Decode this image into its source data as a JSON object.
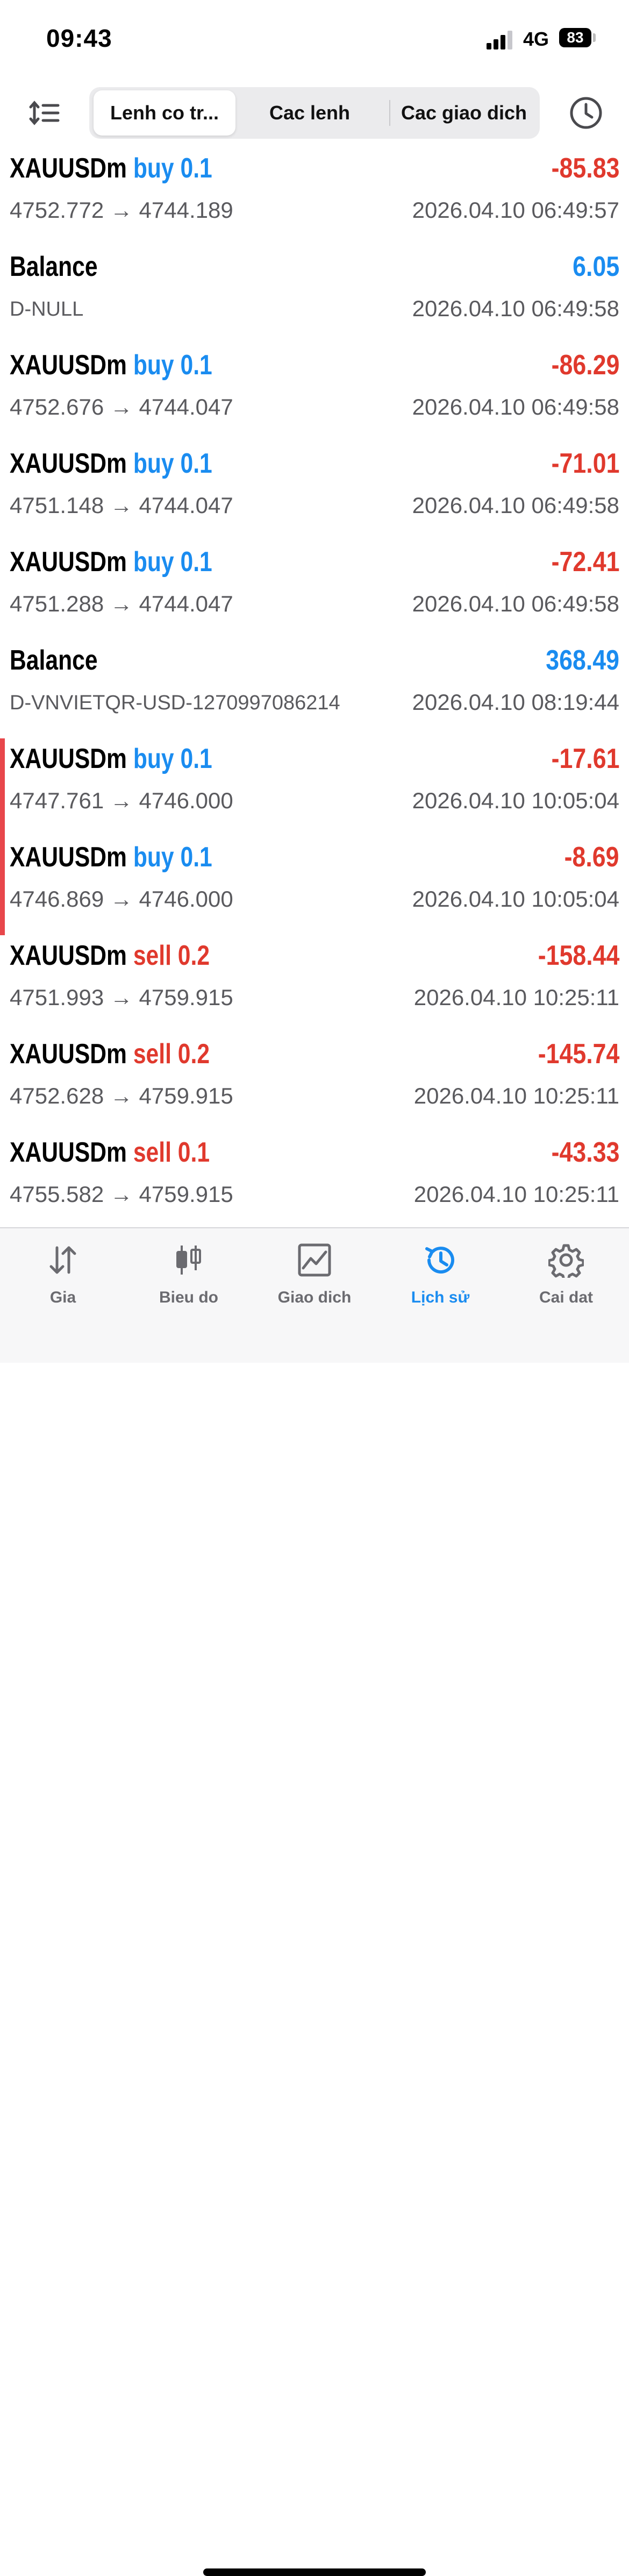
{
  "status_bar": {
    "time": "09:43",
    "network": "4G",
    "battery": "83"
  },
  "toolbar": {
    "tabs": [
      {
        "label": "Lenh co tr...",
        "active": true
      },
      {
        "label": "Cac lenh",
        "active": false
      },
      {
        "label": "Cac giao dich",
        "active": false
      }
    ],
    "sort_icon": "sort-lines-icon",
    "history_icon": "clock-icon"
  },
  "records": [
    {
      "symbol": "XAUUSDm",
      "type": "buy",
      "volume": "0.1",
      "profit": "-85.83",
      "prices": "4752.772 → 4744.189",
      "time": "2026.04.10 06:49:57"
    },
    {
      "symbol": "Balance",
      "profit": "6.05",
      "comment": "D-NULL",
      "time": "2026.04.10 06:49:58"
    },
    {
      "symbol": "XAUUSDm",
      "type": "buy",
      "volume": "0.1",
      "profit": "-86.29",
      "prices": "4752.676 → 4744.047",
      "time": "2026.04.10 06:49:58"
    },
    {
      "symbol": "XAUUSDm",
      "type": "buy",
      "volume": "0.1",
      "profit": "-71.01",
      "prices": "4751.148 → 4744.047",
      "time": "2026.04.10 06:49:58"
    },
    {
      "symbol": "XAUUSDm",
      "type": "buy",
      "volume": "0.1",
      "profit": "-72.41",
      "prices": "4751.288 → 4744.047",
      "time": "2026.04.10 06:49:58"
    },
    {
      "symbol": "Balance",
      "profit": "368.49",
      "comment": "D-VNVIETQR-USD-1270997086214",
      "time": "2026.04.10 08:19:44"
    },
    {
      "symbol": "XAUUSDm",
      "type": "buy",
      "volume": "0.1",
      "profit": "-17.61",
      "prices": "4747.761 → 4746.000",
      "time": "2026.04.10 10:05:04"
    },
    {
      "symbol": "XAUUSDm",
      "type": "buy",
      "volume": "0.1",
      "profit": "-8.69",
      "prices": "4746.869 → 4746.000",
      "time": "2026.04.10 10:05:04"
    },
    {
      "symbol": "XAUUSDm",
      "type": "sell",
      "volume": "0.2",
      "profit": "-158.44",
      "prices": "4751.993 → 4759.915",
      "time": "2026.04.10 10:25:11"
    },
    {
      "symbol": "XAUUSDm",
      "type": "sell",
      "volume": "0.2",
      "profit": "-145.74",
      "prices": "4752.628 → 4759.915",
      "time": "2026.04.10 10:25:11"
    },
    {
      "symbol": "XAUUSDm",
      "type": "sell",
      "volume": "0.1",
      "profit": "-43.33",
      "prices": "4755.582 → 4759.915",
      "time": "2026.04.10 10:25:11"
    }
  ],
  "colors": {
    "buy": "#1a8cf0",
    "sell": "#e0392d",
    "negative": "#e0392d",
    "positive": "#1a8cf0",
    "marker": "#e8474b"
  },
  "tabbar": {
    "items": [
      {
        "label": "Gia",
        "icon": "updown-arrows-icon",
        "active": false
      },
      {
        "label": "Bieu do",
        "icon": "candlestick-icon",
        "active": false
      },
      {
        "label": "Giao dich",
        "icon": "trade-chart-icon",
        "active": false
      },
      {
        "label": "Lịch sử",
        "icon": "history-clock-icon",
        "active": true
      },
      {
        "label": "Cai dat",
        "icon": "gear-icon",
        "active": false
      }
    ]
  }
}
